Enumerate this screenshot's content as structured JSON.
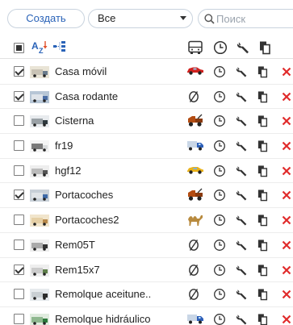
{
  "toolbar": {
    "create_label": "Создать",
    "filter_value": "Все",
    "search_placeholder": "Поиск"
  },
  "header": {
    "columns": [
      "sort-az-icon",
      "hierarchy-icon",
      "bus-icon",
      "clock-icon",
      "wrench-icon",
      "copy-icon"
    ]
  },
  "rows": [
    {
      "name": "Casa móvil",
      "checked": true,
      "type_icon": "red-car-icon"
    },
    {
      "name": "Casa rodante",
      "checked": true,
      "type_icon": "no-icon"
    },
    {
      "name": "Cisterna",
      "checked": false,
      "type_icon": "tow-truck-icon"
    },
    {
      "name": "fr19",
      "checked": false,
      "type_icon": "blue-truck-icon"
    },
    {
      "name": "hgf12",
      "checked": false,
      "type_icon": "yellow-car-icon"
    },
    {
      "name": "Portacoches",
      "checked": true,
      "type_icon": "tow-truck-icon"
    },
    {
      "name": "Portacoches2",
      "checked": false,
      "type_icon": "camel-icon"
    },
    {
      "name": "Rem05T",
      "checked": false,
      "type_icon": "no-icon"
    },
    {
      "name": "Rem15x7",
      "checked": true,
      "type_icon": "no-icon"
    },
    {
      "name": "Remolque aceitune..",
      "checked": false,
      "type_icon": "no-icon"
    },
    {
      "name": "Remolque hidráulico",
      "checked": false,
      "type_icon": "blue-truck-icon"
    }
  ],
  "colors": {
    "accent": "#2a63b8",
    "delete": "#e02b2b",
    "border": "#c9d3de"
  }
}
